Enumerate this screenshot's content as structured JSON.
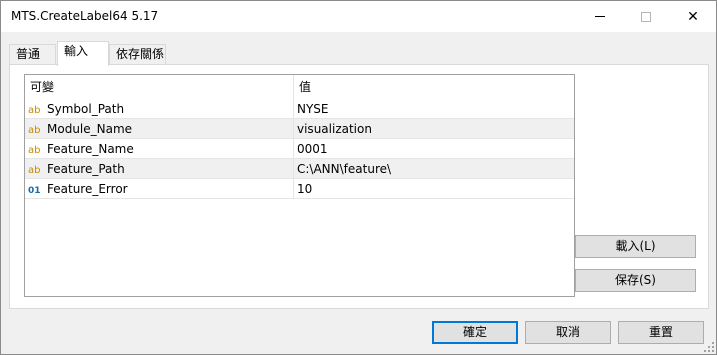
{
  "window": {
    "title": "MTS.CreateLabel64 5.17"
  },
  "tabs": [
    {
      "label": "普通"
    },
    {
      "label": "輸入"
    },
    {
      "label": "依存關係"
    }
  ],
  "grid": {
    "columns": [
      "可變",
      "值"
    ],
    "rows": [
      {
        "type": "ab",
        "name": "Symbol_Path",
        "value": "NYSE"
      },
      {
        "type": "ab",
        "name": "Module_Name",
        "value": "visualization"
      },
      {
        "type": "ab",
        "name": "Feature_Name",
        "value": "0001"
      },
      {
        "type": "ab",
        "name": "Feature_Path",
        "value": "C:\\ANN\\feature\\"
      },
      {
        "type": "01",
        "name": "Feature_Error",
        "value": "10"
      }
    ]
  },
  "side_buttons": {
    "load": "載入(L)",
    "save": "保存(S)"
  },
  "footer": {
    "ok": "確定",
    "cancel": "取消",
    "reset": "重置"
  },
  "icons": {
    "minimize": "minimize-icon",
    "maximize": "maximize-icon",
    "close": "close-icon",
    "close_glyph": "✕"
  }
}
